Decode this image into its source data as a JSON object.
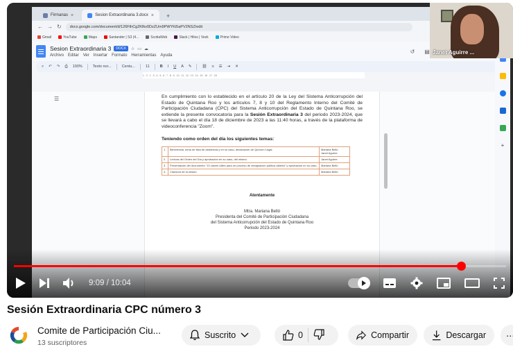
{
  "browser": {
    "tabs": [
      {
        "label": "Firmanas"
      },
      {
        "label": "Sesion Extraordinaria 3.docx"
      }
    ],
    "url": "docs.google.com/document/d/126FthCg2Kfkv0DzZUm9PWYKi5aPV2NSZ/edit",
    "bookmarks": [
      "Gmail",
      "YouTube",
      "Maps",
      "Santander | S3 (4...",
      "ScotiaWeb",
      "Slack | Hilos | Vezk",
      "Prime Video"
    ]
  },
  "docs": {
    "title": "Sesion Extraordinaria 3",
    "badge": "DOCX",
    "menu": [
      "Archivo",
      "Editar",
      "Ver",
      "Insertar",
      "Formato",
      "Herramientas",
      "Ayuda"
    ],
    "toolbar": {
      "zoom": "100%",
      "style": "Texto nor...",
      "font": "Centu...",
      "size": "11"
    },
    "ruler": "1 . 2 . 1 . 3 . 4 . 5 . 6 . 7 . 8 . 9 . 10 . 11 . 12 . 13 . 14 . 15 . 16 . 17 . 18",
    "intro_part1": "En cumplimiento con lo establecido en el artículo 20 de la Ley del Sistema Anticorrupción del Estado de Quintana Roo y los artículos 7, 8 y 10 del Reglamento Interno del Comité de Participación Ciudadana (CPC) del Sistema Anticorrupción del Estado de Quintana Roo, se extiende la presente convocatoria para la ",
    "intro_bold": "Sesión Extraordinaria 3",
    "intro_part2": " del periodo 2023-2024, que se llevará a cabo el día 18 de diciembre de 2023 a las 11:40 horas, a través de la plataforma de videoconferencia \"Zoom\".",
    "order_title": "Teniendo como orden del día los siguientes temas:",
    "agenda": [
      {
        "num": "1.",
        "item": "Bienvenida, toma de lista de asistencia y en su caso, declaración de Quórum Legal.",
        "who": "Mariana Belló\nJanet Aguirre"
      },
      {
        "num": "2.",
        "item": "Lectura del Orden del Día y aprobación en su caso, del mismo.",
        "who": "Janet Aguirre"
      },
      {
        "num": "3.",
        "item": "Presentación del documento \"10 claves útiles para un proceso de designación pública abierta\" y aprobación en su caso.",
        "who": "Mariana Belló"
      },
      {
        "num": "4.",
        "item": "Clausura de la sesión.",
        "who": "Mariana Belló"
      }
    ],
    "sig_head": "Atentamente",
    "sig_name": "Mtra. Mariana Belló",
    "sig_role1": "Presidenta del Comité de Participación Ciudadana",
    "sig_role2": "del Sistema Anticorrupción del Estado de Quintana Roo",
    "sig_period": "Periodo 2023-2024"
  },
  "presenter": {
    "name": "Janet Aguirre ..."
  },
  "watermark": "zoom",
  "player": {
    "current_time": "9:09",
    "duration": "10:04",
    "time_display": "9:09 / 10:04",
    "progress_fraction": 0.909
  },
  "video": {
    "title": "Sesión Extraordinaria CPC número 3",
    "channel": "Comite de Participación Ciu...",
    "subscribers": "13 suscriptores",
    "subscribe_label": "Suscrito",
    "likes": "0",
    "share_label": "Compartir",
    "download_label": "Descargar"
  },
  "colors": {
    "accent": "#ff0000",
    "docs_blue": "#4285f4"
  }
}
